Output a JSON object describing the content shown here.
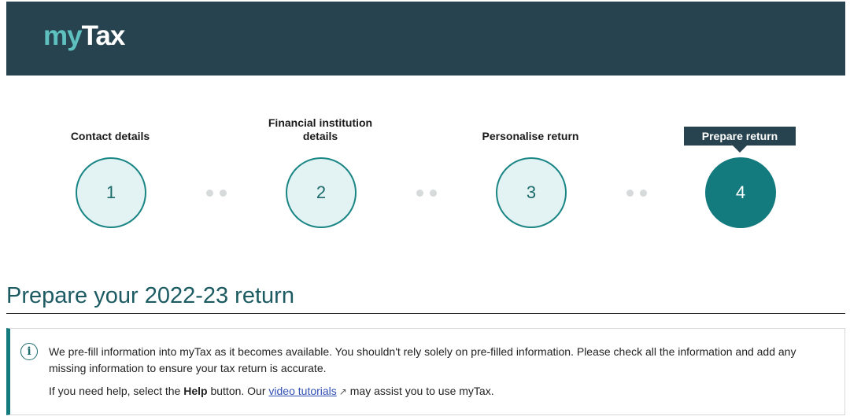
{
  "header": {
    "logo_my": "my",
    "logo_tax": "Tax"
  },
  "steps": [
    {
      "number": "1",
      "label": "Contact details",
      "active": false
    },
    {
      "number": "2",
      "label": "Financial institution details",
      "active": false
    },
    {
      "number": "3",
      "label": "Personalise return",
      "active": false
    },
    {
      "number": "4",
      "label": "Prepare return",
      "active": true
    }
  ],
  "page": {
    "title": "Prepare your 2022-23 return"
  },
  "info": {
    "icon": "info-icon",
    "message": "We pre-fill information into myTax as it becomes available. You shouldn't rely solely on pre-filled information. Please check all the information and add any missing information to ensure your tax return is accurate.",
    "help_prefix": "If you need help, select the ",
    "help_bold": "Help",
    "help_middle": " button. Our ",
    "help_link": "video tutorials",
    "help_suffix": " may assist you to use myTax."
  },
  "colors": {
    "header_bg": "#27434f",
    "accent": "#137a7e",
    "logo_accent": "#5fc0c0"
  }
}
